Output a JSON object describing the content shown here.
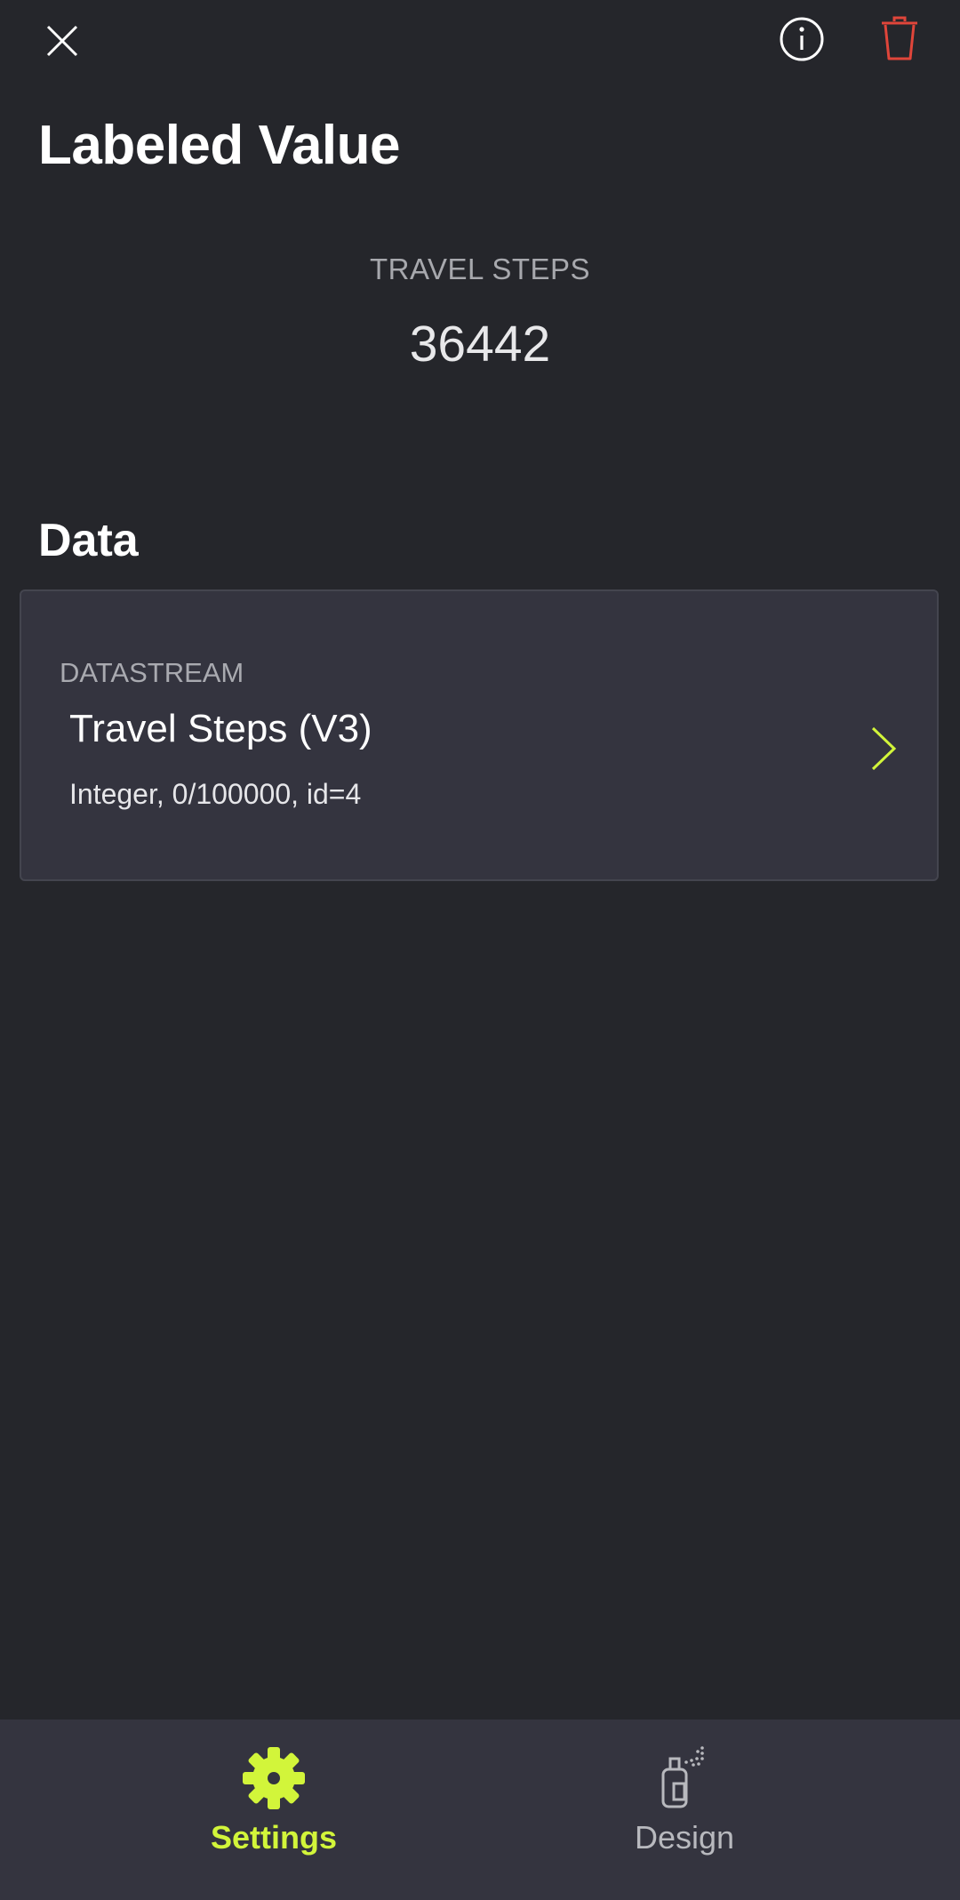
{
  "header": {
    "title": "Labeled Value",
    "close_icon": "close-icon",
    "info_icon": "info-icon",
    "delete_icon": "trash-icon",
    "delete_color": "#e0453a"
  },
  "preview": {
    "label": "TRAVEL STEPS",
    "value": "36442"
  },
  "data_section": {
    "title": "Data",
    "datastream": {
      "label": "DATASTREAM",
      "name": "Travel Steps (V3)",
      "description": "Integer, 0/100000, id=4",
      "chevron_icon": "chevron-right-icon",
      "chevron_color": "#d2f53a"
    }
  },
  "bottom_nav": {
    "tabs": [
      {
        "label": "Settings",
        "icon": "gear-icon",
        "active": true,
        "color": "#d2f53a"
      },
      {
        "label": "Design",
        "icon": "spray-can-icon",
        "active": false,
        "color": "#b8b9be"
      }
    ]
  }
}
